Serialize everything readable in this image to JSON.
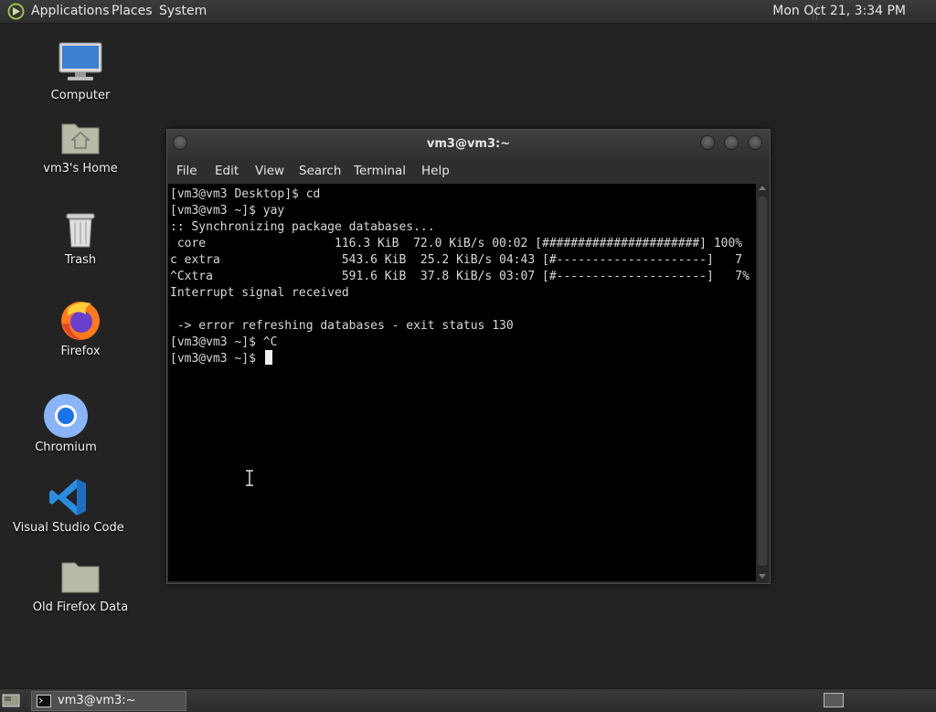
{
  "top_panel": {
    "menus": [
      "Applications",
      "Places",
      "System"
    ],
    "clock": "Mon Oct 21,  3:34 PM"
  },
  "desktop_icons": [
    {
      "label": "Computer",
      "icon": "computer-icon"
    },
    {
      "label": "vm3's Home",
      "icon": "home-folder-icon"
    },
    {
      "label": "Trash",
      "icon": "trash-icon"
    },
    {
      "label": "Firefox",
      "icon": "firefox-icon"
    },
    {
      "label": "Chromium",
      "icon": "chromium-icon"
    },
    {
      "label": "Visual Studio Code",
      "icon": "vscode-icon"
    },
    {
      "label": "Old Firefox Data",
      "icon": "folder-icon"
    }
  ],
  "terminal": {
    "title": "vm3@vm3:~",
    "menu": [
      "File",
      "Edit",
      "View",
      "Search",
      "Terminal",
      "Help"
    ],
    "lines": [
      "[vm3@vm3 Desktop]$ cd",
      "[vm3@vm3 ~]$ yay",
      ":: Synchronizing package databases...",
      " core                  116.3 KiB  72.0 KiB/s 00:02 [######################] 100%",
      "c extra                 543.6 KiB  25.2 KiB/s 04:43 [#---------------------]   7",
      "^Cxtra                  591.6 KiB  37.8 KiB/s 03:07 [#---------------------]   7%",
      "Interrupt signal received",
      "",
      " -> error refreshing databases - exit status 130",
      "[vm3@vm3 ~]$ ^C",
      "[vm3@vm3 ~]$ "
    ]
  },
  "taskbar": {
    "task_label": "vm3@vm3:~"
  }
}
